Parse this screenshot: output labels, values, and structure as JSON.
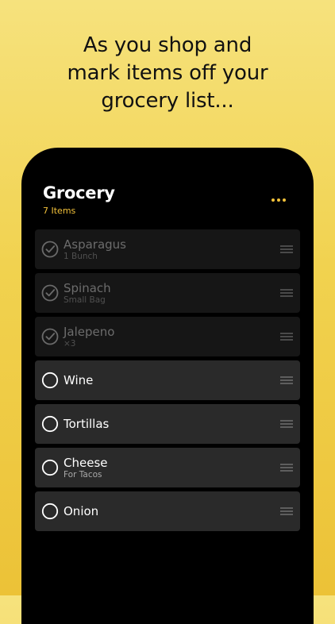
{
  "headline": {
    "lines": [
      "As you shop and",
      "mark items off your",
      "grocery list..."
    ]
  },
  "list": {
    "title": "Grocery",
    "count_label": "7 Items",
    "items": [
      {
        "name": "Asparagus",
        "note": "1 Bunch",
        "checked": true
      },
      {
        "name": "Spinach",
        "note": "Small Bag",
        "checked": true
      },
      {
        "name": "Jalepeno",
        "note": "×3",
        "checked": true
      },
      {
        "name": "Wine",
        "note": "",
        "checked": false
      },
      {
        "name": "Tortillas",
        "note": "",
        "checked": false
      },
      {
        "name": "Cheese",
        "note": "For Tacos",
        "checked": false
      },
      {
        "name": "Onion",
        "note": "",
        "checked": false
      }
    ]
  },
  "icons": {
    "more": "more-dots-icon",
    "checked": "checkmark-circle-icon",
    "unchecked": "empty-circle-icon",
    "reorder": "drag-handle-icon"
  },
  "colors": {
    "accent": "#f3c23a",
    "background_top": "#f6e27d",
    "background_bottom": "#ecc237",
    "device": "#000000",
    "row_active": "#2a2a2a",
    "row_done": "#161616"
  }
}
